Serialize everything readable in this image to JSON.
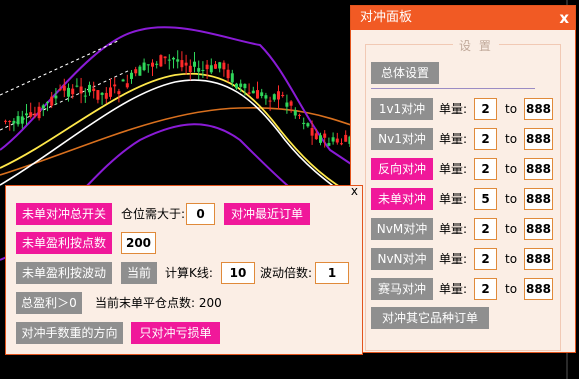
{
  "right_panel": {
    "title": "对冲面板",
    "close": "x",
    "settings_legend": "设 置",
    "overall_settings": "总体设置",
    "qty_label": "单量:",
    "to_label": "to",
    "rows": [
      {
        "label": "1v1对冲",
        "active": false,
        "from": "2",
        "to": "888"
      },
      {
        "label": "Nv1对冲",
        "active": false,
        "from": "2",
        "to": "888"
      },
      {
        "label": "反向对冲",
        "active": true,
        "from": "2",
        "to": "888"
      },
      {
        "label": "未单对冲",
        "active": true,
        "from": "5",
        "to": "888"
      },
      {
        "label": "NvM对冲",
        "active": false,
        "from": "2",
        "to": "888"
      },
      {
        "label": "NvN对冲",
        "active": false,
        "from": "2",
        "to": "888"
      },
      {
        "label": "赛马对冲",
        "active": false,
        "from": "2",
        "to": "888"
      }
    ],
    "hedge_other": "对冲其它品种订单"
  },
  "left_panel": {
    "close": "x",
    "btn_total_switch": "未单对冲总开关",
    "position_label": "仓位需大于:",
    "position_value": "0",
    "btn_hedge_recent": "对冲最近订单",
    "btn_tail_profit_points": "未单盈利按点数",
    "tail_profit_points_value": "200",
    "btn_tail_profit_volatility": "未单盈利按波动",
    "btn_current": "当前",
    "calc_k_label": "计算K线:",
    "calc_k_value": "10",
    "volatility_mult_label": "波动倍数:",
    "volatility_mult_value": "1",
    "btn_total_profit": "总盈利＞0",
    "tail_close_points_text": "当前末单平仓点数: 200",
    "btn_hedge_direction": "对冲手数重的方向",
    "btn_only_loss": "只对冲亏损单"
  },
  "colors": {
    "accent": "#f15a24",
    "pink": "#f0189a",
    "gray": "#8f8f8f",
    "panel_bg": "#fbeee5"
  }
}
